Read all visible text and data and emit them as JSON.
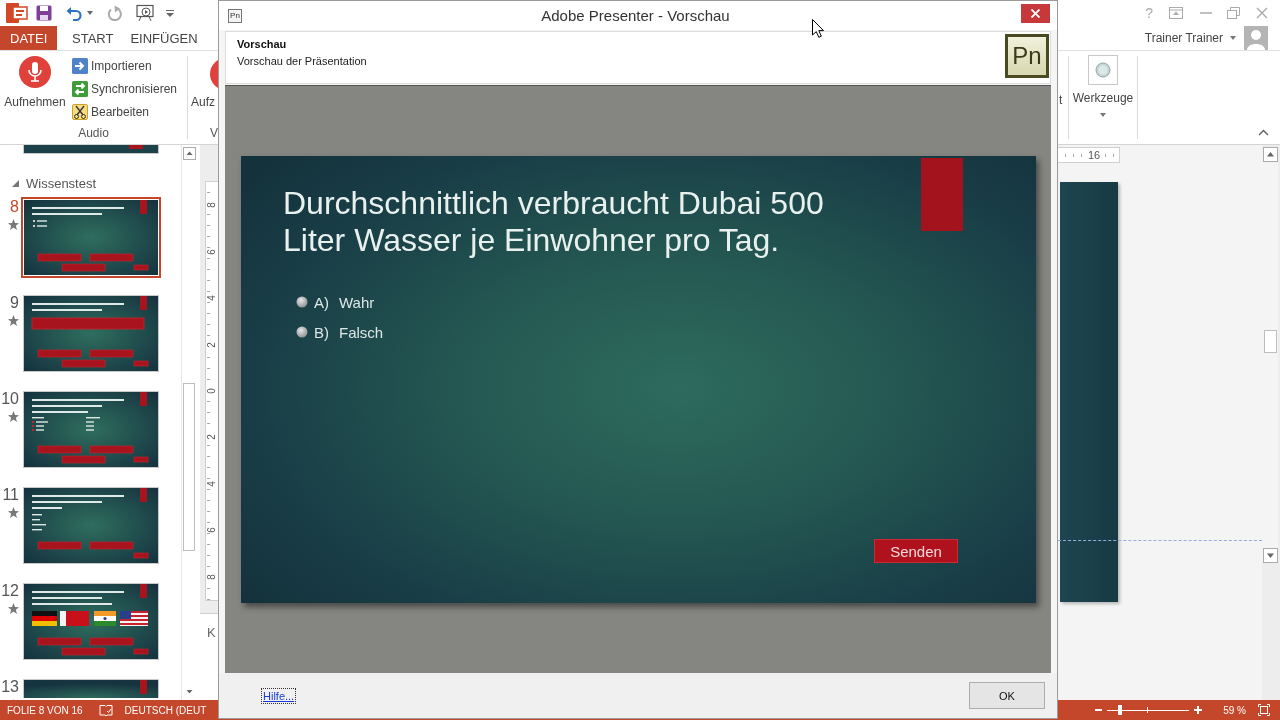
{
  "window_controls": {
    "help": "?"
  },
  "tabs": [
    {
      "label": "DATEI",
      "kind": "file",
      "selected": false
    },
    {
      "label": "START",
      "kind": "tab",
      "selected": false
    },
    {
      "label": "EINFÜGEN",
      "kind": "tab",
      "selected": false
    }
  ],
  "account": {
    "name": "Trainer Trainer"
  },
  "ribbon": {
    "audio_group": {
      "label": "Audio",
      "record_button": "Aufnehmen",
      "buttons": [
        {
          "label": "Importieren",
          "kind": "import"
        },
        {
          "label": "Synchronisieren",
          "kind": "sync"
        },
        {
          "label": "Bearbeiten",
          "kind": "edit"
        }
      ]
    },
    "cut_group": {
      "button": "Aufz",
      "label": "V"
    },
    "right_group": {
      "cut_label": "t",
      "tools_button": "Werkzeuge"
    }
  },
  "slide_panel": {
    "slides_above": [
      {
        "kind": "bottom_edge",
        "selected": false
      }
    ],
    "section": {
      "title": "Wissenstest",
      "expanded": true,
      "slides": [
        {
          "number": "8",
          "kind": "true_false",
          "selected": true
        },
        {
          "number": "9",
          "kind": "fill_in",
          "selected": false
        },
        {
          "number": "10",
          "kind": "matching",
          "selected": false
        },
        {
          "number": "11",
          "kind": "choice",
          "selected": false
        },
        {
          "number": "12",
          "kind": "flags",
          "selected": false
        },
        {
          "number": "13",
          "kind": "top_edge",
          "selected": false
        }
      ]
    }
  },
  "vertical_ruler": [
    "8",
    "6",
    "4",
    "2",
    "0",
    "2",
    "4",
    "6",
    "8"
  ],
  "horizontal_ruler": [
    "16"
  ],
  "notes": {
    "text": "K"
  },
  "status_bar": {
    "slide_info": "FOLIE 8 VON 16",
    "language": "DEUTSCH (DEUT",
    "zoom": {
      "level": 0.15,
      "reading": "59 %"
    }
  },
  "dialog": {
    "title": "Adobe Presenter - Vorschau",
    "icon": "Pn",
    "header": {
      "title": "Vorschau",
      "subtitle": "Vorschau der Präsentation",
      "logo": "Pn"
    },
    "slide": {
      "question": "Durchschnittlich verbraucht Dubai 500 Liter Wasser je Einwohner pro Tag.",
      "options": [
        {
          "letter": "A)",
          "text": "Wahr",
          "selected": false
        },
        {
          "letter": "B)",
          "text": "Falsch",
          "selected": false
        }
      ],
      "submit": "Senden"
    },
    "help_link": "Hilfe...",
    "ok_button": "OK"
  }
}
